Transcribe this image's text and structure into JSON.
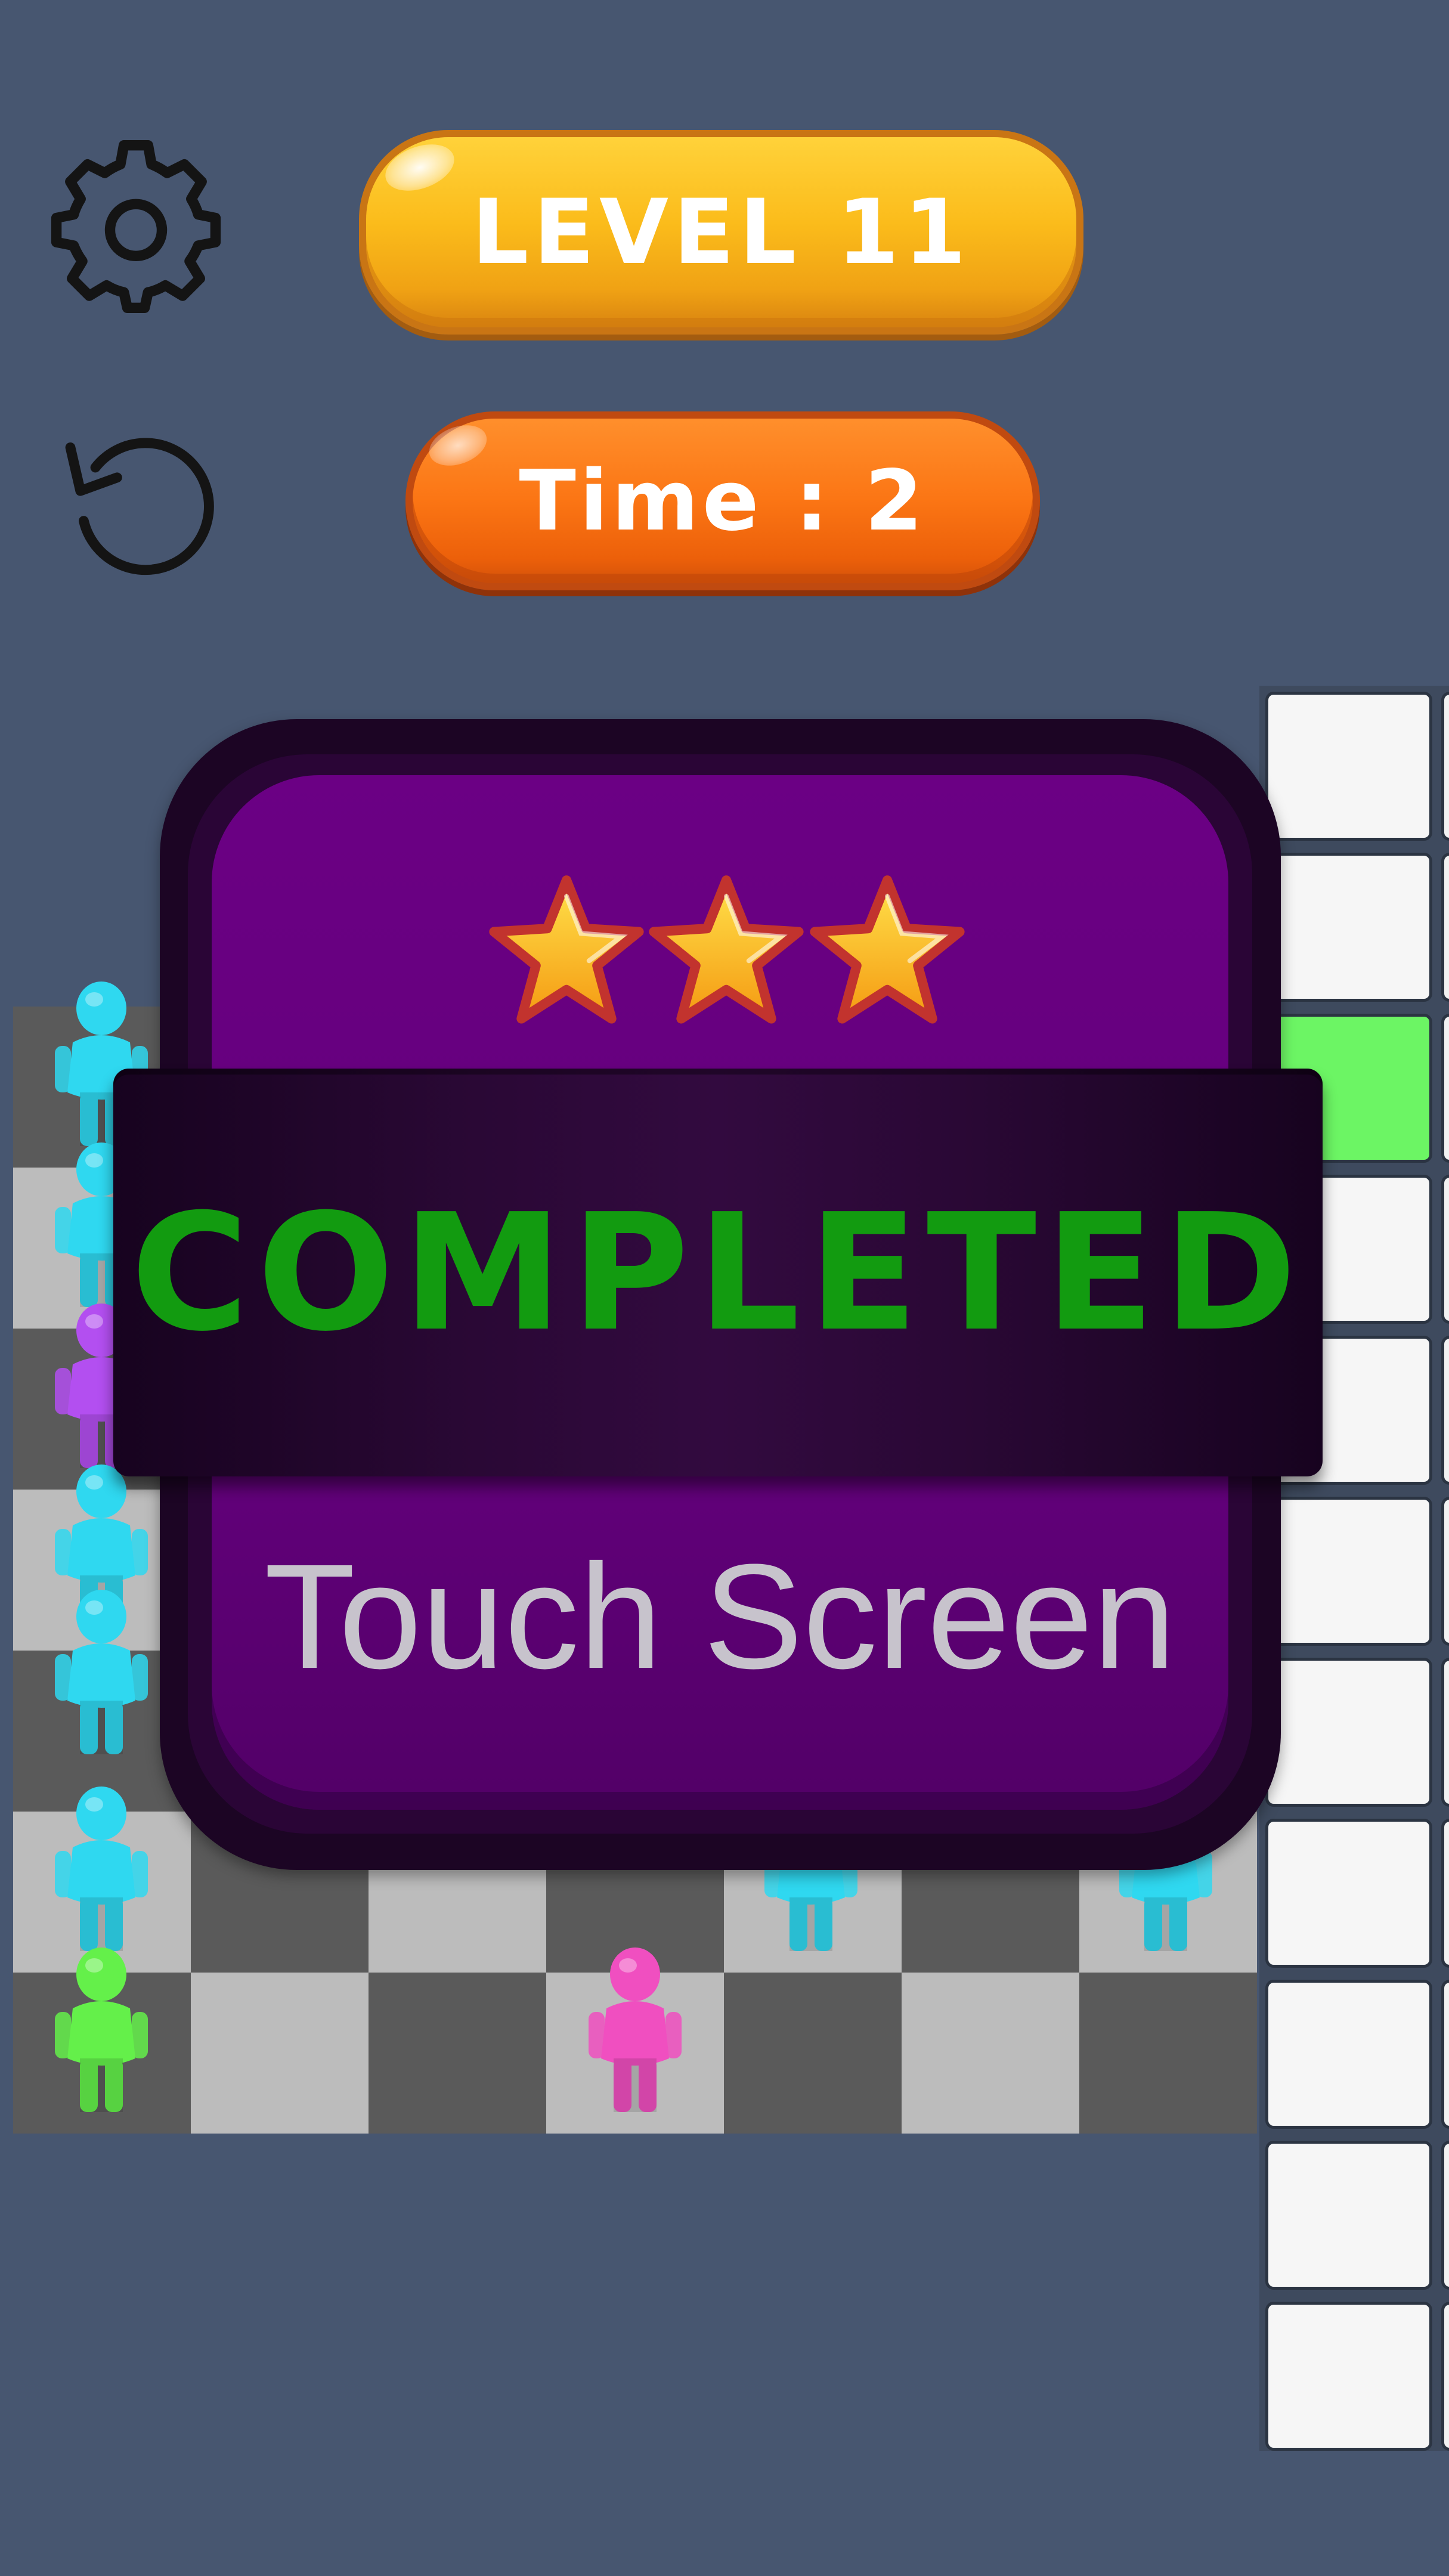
{
  "hud": {
    "settings_icon": "gear-icon",
    "restart_icon": "restart-icon",
    "level_label": "LEVEL 11",
    "time_label": "Time : 2"
  },
  "result_panel": {
    "stars_earned": 3,
    "stars_total": 3,
    "title": "COMPLETED",
    "subtitle": "Touch Screen",
    "title_color": "#129b10",
    "subtitle_color": "#c7c3cc",
    "panel_color": "#6b0084"
  },
  "board": {
    "rows": 7,
    "cols": 7,
    "light_cell": "#bcbcbc",
    "dark_cell": "#5a5a5a"
  },
  "tile_column": {
    "tiles": 11,
    "highlighted_tile": 3,
    "highlight_color": "#6cf564"
  },
  "characters": [
    {
      "color": "#2fd8f0",
      "name": "cyan"
    },
    {
      "color": "#b34ff0",
      "name": "purple"
    },
    {
      "color": "#64f04a",
      "name": "green"
    },
    {
      "color": "#f04fc0",
      "name": "pink"
    }
  ]
}
